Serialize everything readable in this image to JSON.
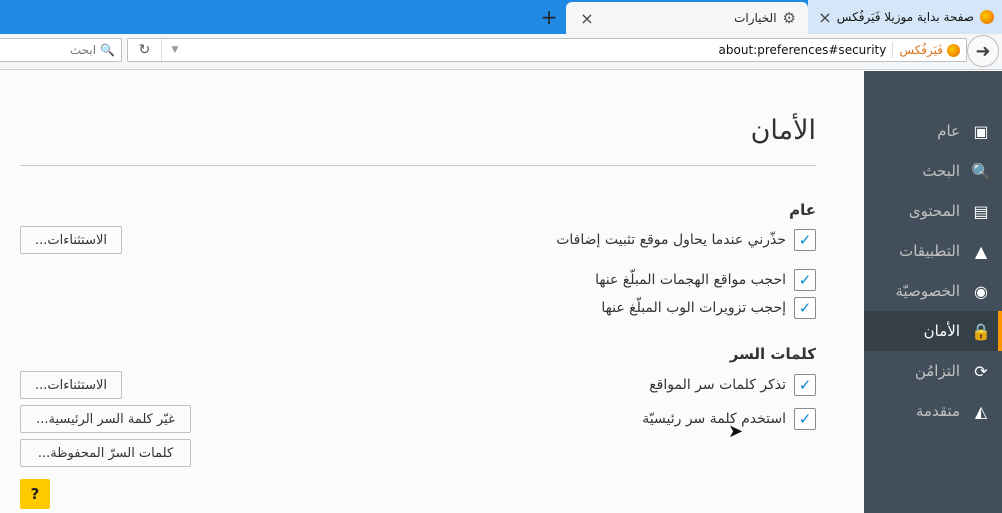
{
  "tabs": {
    "active": {
      "label": "الخيارات",
      "icon": "gear-icon"
    },
    "inactive": {
      "label": "صفحة بداية موزيلا فَيَرفُكس",
      "icon": "firefox-icon"
    },
    "close_glyph": "×",
    "new_tab_glyph": "+"
  },
  "navbar": {
    "url": "about:preferences#security",
    "identity_label": "فَيَرفُكس",
    "search_placeholder": "ابحث",
    "back_glyph": "➜",
    "reload_glyph": "↻",
    "dropdown_glyph": "▼"
  },
  "sidebar": {
    "items": [
      {
        "label": "عام",
        "icon": "general-icon",
        "glyph": "▣"
      },
      {
        "label": "البحث",
        "icon": "search-icon",
        "glyph": "🔍"
      },
      {
        "label": "المحتوى",
        "icon": "content-icon",
        "glyph": "▤"
      },
      {
        "label": "التطبيقات",
        "icon": "applications-icon",
        "glyph": "▲"
      },
      {
        "label": "الخصوصيّة",
        "icon": "privacy-mask-icon",
        "glyph": "◉"
      },
      {
        "label": "الأمان",
        "icon": "security-lock-icon",
        "glyph": "🔒"
      },
      {
        "label": "التزامُن",
        "icon": "sync-icon",
        "glyph": "⟳"
      },
      {
        "label": "متقدمة",
        "icon": "advanced-wizard-icon",
        "glyph": "◭"
      }
    ],
    "selected": "الأمان"
  },
  "main": {
    "title": "الأمان",
    "general": {
      "heading": "عام",
      "warn_addons": "حذّرني عندما يحاول موقع تثبيت إضافات",
      "block_attack": "احجب مواقع الهجمات المبلّغ عنها",
      "block_forgery": "إحجب تزويرات الوب المبلّغ عنها",
      "exceptions_button": "الاستثناءات..."
    },
    "passwords": {
      "heading": "كلمات السر",
      "remember": "تذكر كلمات سر المواقع",
      "use_master": "استخدم كلمة سر رئيسيّة",
      "exceptions_button": "الاستثناءات...",
      "change_master_button": "غيّر كلمة السر الرئيسية...",
      "saved_button": "كلمات السرّ المحفوظة..."
    },
    "help_label": "?",
    "check_glyph": "✓"
  }
}
